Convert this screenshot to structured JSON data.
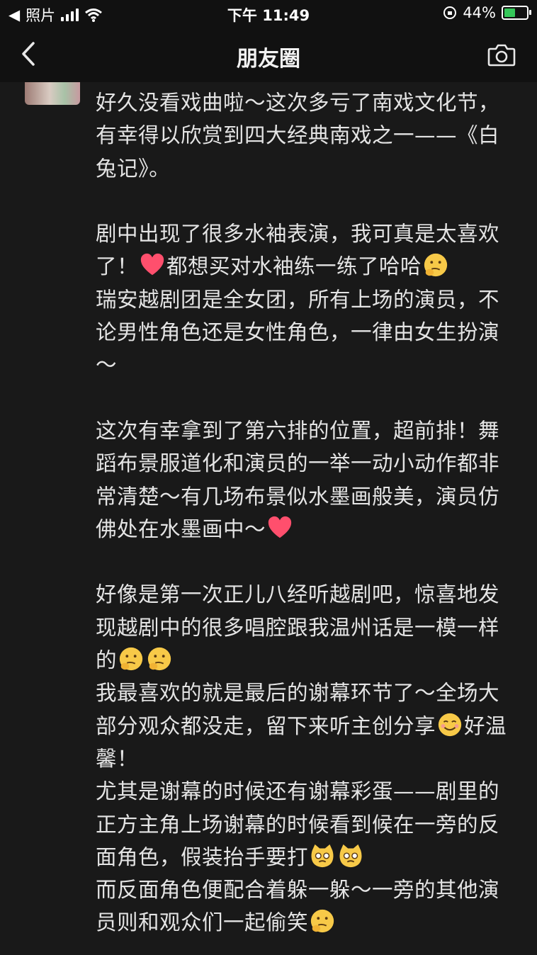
{
  "status_bar": {
    "back_app": "照片",
    "time": "下午 11:49",
    "battery_percent": "44%",
    "battery_level": 0.44
  },
  "nav": {
    "title": "朋友圈",
    "back_icon": "chevron-left-icon",
    "camera_icon": "camera-icon"
  },
  "post": {
    "paragraphs": [
      "好久没看戏曲啦～这次多亏了南戏文化节，有幸得以欣赏到四大经典南戏之一——《白兔记》。",
      "",
      "剧中出现了很多水袖表演，我可真是太喜欢了！",
      "瑞安越剧团是全女团，所有上场的演员，不论男性角色还是女性角色，一律由女生扮演～",
      "",
      "这次有幸拿到了第六排的位置，超前排！舞蹈布景服道化和演员的一举一动小动作都非常清楚～有几场布景似水墨画般美，演员仿佛处在水墨画中～",
      "",
      "好像是第一次正儿八经听越剧吧，惊喜地发现越剧中的很多唱腔跟我温州话是一模一样的",
      "我最喜欢的就是最后的谢幕环节了～全场大部分观众都没走，留下来听主创分享",
      "尤其是谢幕的时候还有谢幕彩蛋——剧里的正方主角上场谢幕的时候看到候在一旁的反面角色，假装抬手要打",
      "而反面角色便配合着躲一躲～一旁的其他演员则和观众们一起偷笑"
    ],
    "inline_parts": {
      "p3_a": "剧中出现了很多水袖表演，我可真是太喜欢了！",
      "p3_b": "都想买对水袖练一练了哈哈",
      "p9_a": "我最喜欢的就是最后的谢幕环节了～全场大部分观众都没走，留下来听主创分享",
      "p9_b": "好温馨！"
    },
    "emojis": {
      "heart": "heart-icon",
      "thinking": "thinking-face-icon",
      "smile": "smiling-face-icon",
      "cat": "cat-face-icon"
    }
  }
}
